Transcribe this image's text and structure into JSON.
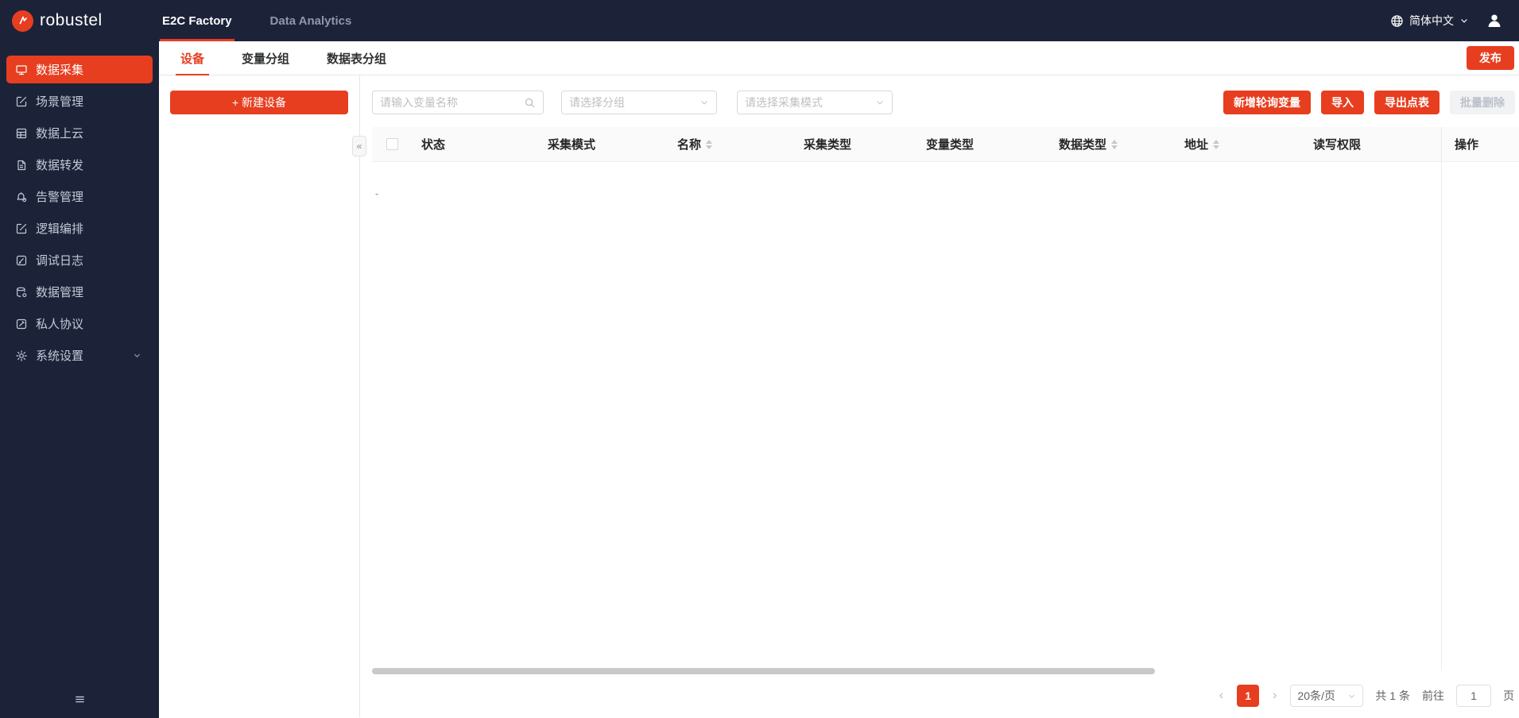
{
  "colors": {
    "accent": "#e73e20",
    "topbar_bg": "#1c2339"
  },
  "topbar": {
    "brand": "robustel",
    "nav": [
      {
        "label": "E2C Factory",
        "active": true
      },
      {
        "label": "Data Analytics",
        "active": false
      }
    ],
    "language": "简体中文"
  },
  "sidebar": {
    "items": [
      {
        "label": "数据采集",
        "icon": "monitor-icon",
        "active": true
      },
      {
        "label": "场景管理",
        "icon": "edit-square-icon",
        "active": false
      },
      {
        "label": "数据上云",
        "icon": "grid-icon",
        "active": false
      },
      {
        "label": "数据转发",
        "icon": "file-icon",
        "active": false
      },
      {
        "label": "告警管理",
        "icon": "alarm-bell-icon",
        "active": false
      },
      {
        "label": "逻辑编排",
        "icon": "edit-square-icon",
        "active": false
      },
      {
        "label": "调试日志",
        "icon": "log-book-icon",
        "active": false
      },
      {
        "label": "数据管理",
        "icon": "database-icon",
        "active": false
      },
      {
        "label": "私人协议",
        "icon": "protocol-book-icon",
        "active": false
      },
      {
        "label": "系统设置",
        "icon": "gear-icon",
        "active": false,
        "expandable": true
      }
    ]
  },
  "tabs": [
    {
      "label": "设备",
      "active": true
    },
    {
      "label": "变量分组",
      "active": false
    },
    {
      "label": "数据表分组",
      "active": false
    }
  ],
  "publish_label": "发布",
  "left_panel": {
    "new_device_plus": "+",
    "new_device_label": "新建设备",
    "collapse_glyph": "«"
  },
  "filters": {
    "search_placeholder": "请输入变量名称",
    "group_placeholder": "请选择分组",
    "mode_placeholder": "请选择采集模式"
  },
  "actions": [
    {
      "label": "新增轮询变量",
      "disabled": false
    },
    {
      "label": "导入",
      "disabled": false
    },
    {
      "label": "导出点表",
      "disabled": false
    },
    {
      "label": "批量删除",
      "disabled": true
    }
  ],
  "table": {
    "columns": [
      {
        "label": "状态",
        "sortable": false
      },
      {
        "label": "采集模式",
        "sortable": false
      },
      {
        "label": "名称",
        "sortable": true
      },
      {
        "label": "采集类型",
        "sortable": false
      },
      {
        "label": "变量类型",
        "sortable": false
      },
      {
        "label": "数据类型",
        "sortable": true
      },
      {
        "label": "地址",
        "sortable": true
      },
      {
        "label": "读写权限",
        "sortable": false
      },
      {
        "label": "操作",
        "sortable": false
      }
    ],
    "empty_dash": "-"
  },
  "pagination": {
    "prev_glyph": "‹",
    "next_glyph": "›",
    "current_page": "1",
    "page_size_label": "20条/页",
    "total_label": "共 1 条",
    "goto_label": "前往",
    "goto_value": "1",
    "page_unit": "页"
  }
}
